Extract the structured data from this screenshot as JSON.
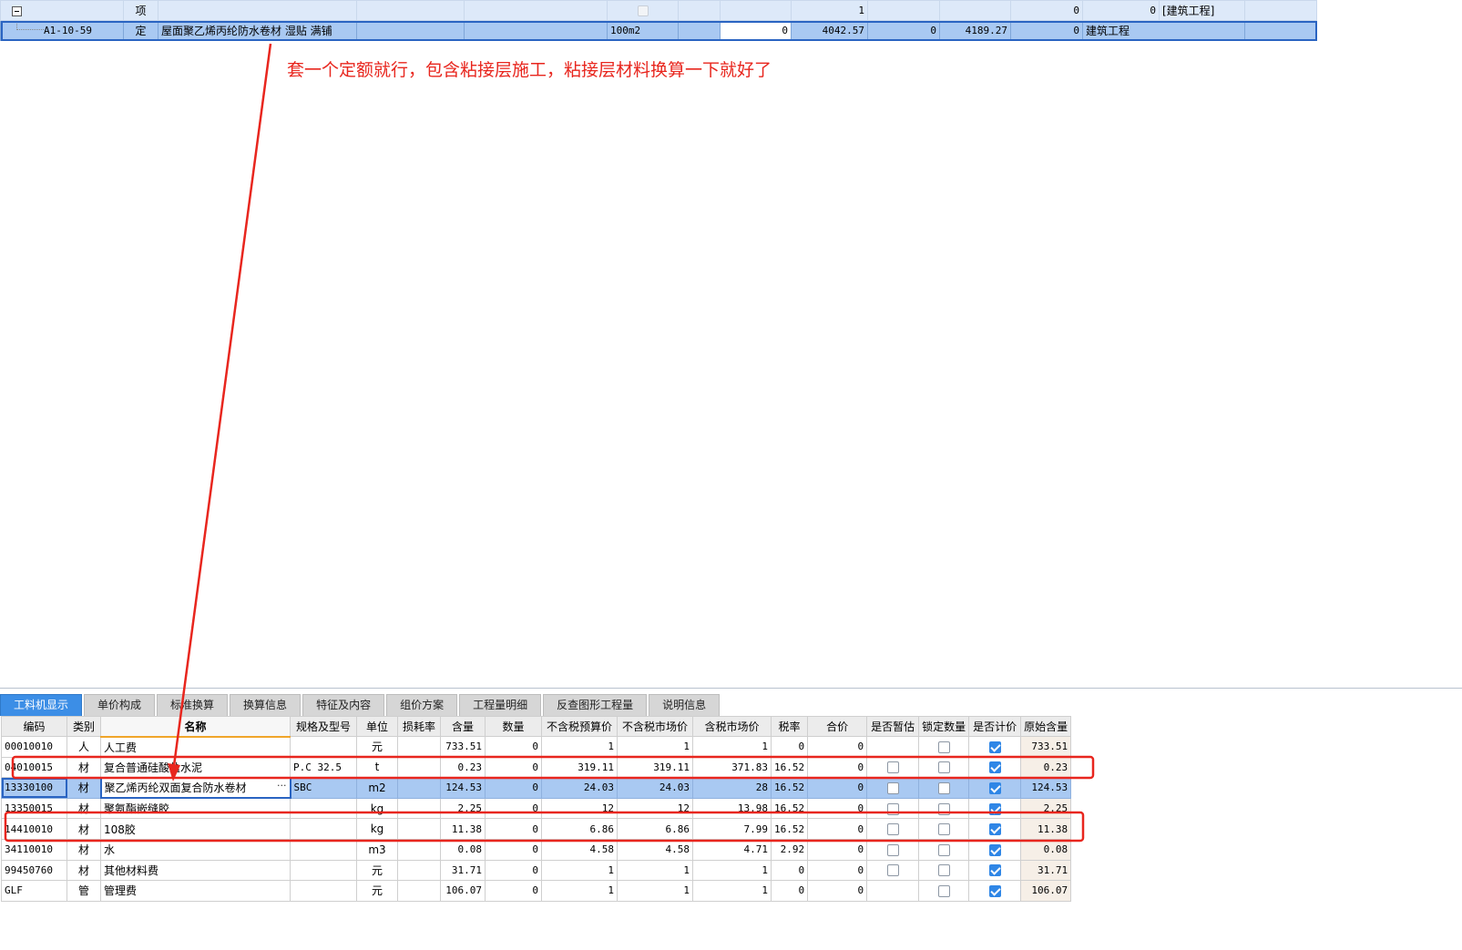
{
  "top_grid": {
    "rows": [
      {
        "code": "",
        "type": "项",
        "name": "",
        "unit": "",
        "qty": "",
        "c8": "1",
        "c9": "",
        "c10": "",
        "c11": "0",
        "c12": "0",
        "project": "[建筑工程]"
      },
      {
        "code": "A1-10-59",
        "type": "定",
        "name": "屋面聚乙烯丙纶防水卷材 湿贴 满铺",
        "unit": "100m2",
        "qty": "",
        "c8": "0",
        "c9": "4042.57",
        "c10": "0",
        "c11": "4189.27",
        "c12": "0",
        "project": "建筑工程"
      }
    ]
  },
  "annotation": {
    "text": "套一个定额就行，包含粘接层施工，粘接层材料换算一下就好了",
    "color": "#e8261e"
  },
  "tabs": [
    "工料机显示",
    "单价构成",
    "标准换算",
    "换算信息",
    "特征及内容",
    "组价方案",
    "工程量明细",
    "反查图形工程量",
    "说明信息"
  ],
  "active_tab": 0,
  "grid": {
    "headers": [
      "编码",
      "类别",
      "名称",
      "规格及型号",
      "单位",
      "损耗率",
      "含量",
      "数量",
      "不含税预算价",
      "不含税市场价",
      "含税市场价",
      "税率",
      "合价",
      "是否暂估",
      "锁定数量",
      "是否计价",
      "原始含量"
    ],
    "rows": [
      {
        "code": "00010010",
        "cat": "人",
        "name": "人工费",
        "spec": "",
        "unit": "元",
        "loss": "",
        "content": "733.51",
        "qty": "0",
        "budget": "1",
        "market": "1",
        "taxmarket": "1",
        "rate": "0",
        "total": "0",
        "est": null,
        "lock": false,
        "priced": true,
        "orig": "733.51"
      },
      {
        "code": "04010015",
        "cat": "材",
        "name": "复合普通硅酸盐水泥",
        "spec": "P.C 32.5",
        "unit": "t",
        "loss": "",
        "content": "0.23",
        "qty": "0",
        "budget": "319.11",
        "market": "319.11",
        "taxmarket": "371.83",
        "rate": "16.52",
        "total": "0",
        "est": false,
        "lock": false,
        "priced": true,
        "orig": "0.23"
      },
      {
        "code": "13330100",
        "cat": "材",
        "name": "聚乙烯丙纶双面复合防水卷材",
        "spec": "SBC",
        "unit": "m2",
        "loss": "",
        "content": "124.53",
        "qty": "0",
        "budget": "24.03",
        "market": "24.03",
        "taxmarket": "28",
        "rate": "16.52",
        "total": "0",
        "est": false,
        "lock": false,
        "priced": true,
        "orig": "124.53"
      },
      {
        "code": "13350015",
        "cat": "材",
        "name": "聚氨酯嵌缝胶",
        "spec": "",
        "unit": "kg",
        "loss": "",
        "content": "2.25",
        "qty": "0",
        "budget": "12",
        "market": "12",
        "taxmarket": "13.98",
        "rate": "16.52",
        "total": "0",
        "est": false,
        "lock": false,
        "priced": true,
        "orig": "2.25"
      },
      {
        "code": "14410010",
        "cat": "材",
        "name": "108胶",
        "spec": "",
        "unit": "kg",
        "loss": "",
        "content": "11.38",
        "qty": "0",
        "budget": "6.86",
        "market": "6.86",
        "taxmarket": "7.99",
        "rate": "16.52",
        "total": "0",
        "est": false,
        "lock": false,
        "priced": true,
        "orig": "11.38"
      },
      {
        "code": "34110010",
        "cat": "材",
        "name": "水",
        "spec": "",
        "unit": "m3",
        "loss": "",
        "content": "0.08",
        "qty": "0",
        "budget": "4.58",
        "market": "4.58",
        "taxmarket": "4.71",
        "rate": "2.92",
        "total": "0",
        "est": false,
        "lock": false,
        "priced": true,
        "orig": "0.08"
      },
      {
        "code": "99450760",
        "cat": "材",
        "name": "其他材料费",
        "spec": "",
        "unit": "元",
        "loss": "",
        "content": "31.71",
        "qty": "0",
        "budget": "1",
        "market": "1",
        "taxmarket": "1",
        "rate": "0",
        "total": "0",
        "est": false,
        "lock": false,
        "priced": true,
        "orig": "31.71"
      },
      {
        "code": "GLF",
        "cat": "管",
        "name": "管理费",
        "spec": "",
        "unit": "元",
        "loss": "",
        "content": "106.07",
        "qty": "0",
        "budget": "1",
        "market": "1",
        "taxmarket": "1",
        "rate": "0",
        "total": "0",
        "est": null,
        "lock": false,
        "priced": true,
        "orig": "106.07"
      }
    ],
    "selected_row": 2
  }
}
